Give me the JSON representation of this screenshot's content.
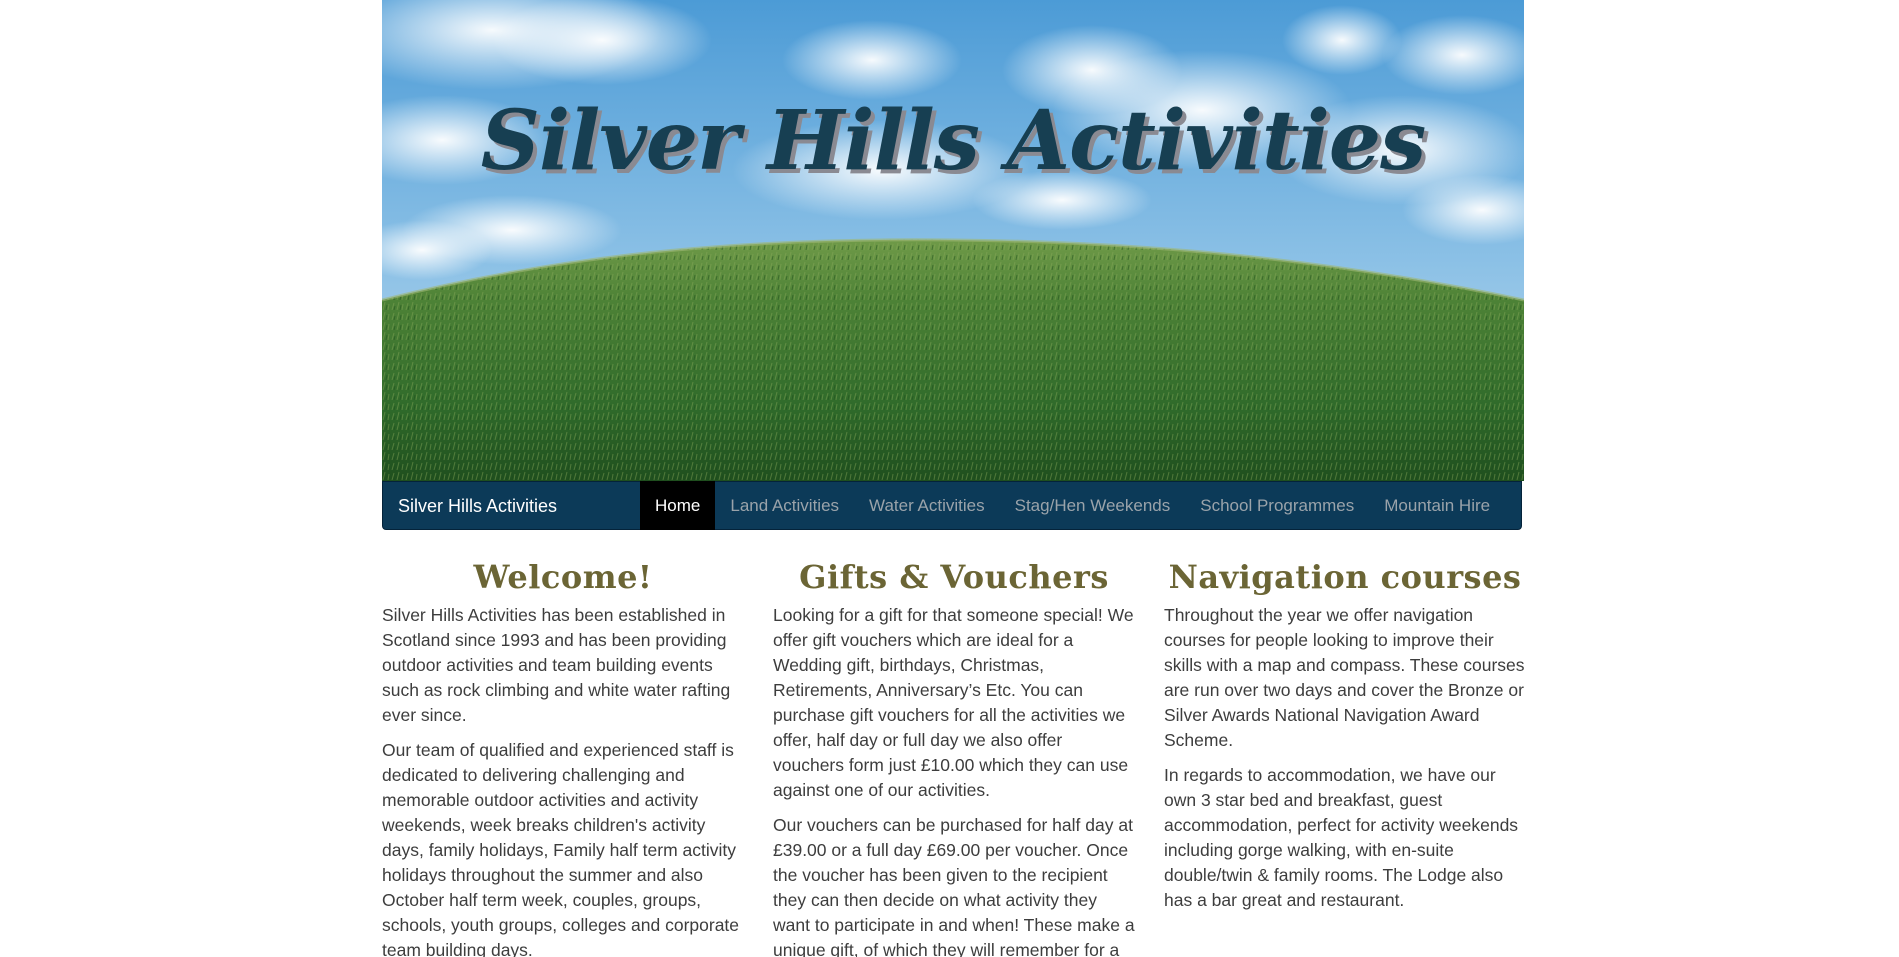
{
  "hero": {
    "title": "Silver Hills Activities"
  },
  "navbar": {
    "brand": "Silver Hills Activities",
    "items": [
      {
        "label": "Home",
        "active": true
      },
      {
        "label": "Land Activities",
        "active": false
      },
      {
        "label": "Water Activities",
        "active": false
      },
      {
        "label": "Stag/Hen Weekends",
        "active": false
      },
      {
        "label": "School Programmes",
        "active": false
      },
      {
        "label": "Mountain Hire",
        "active": false
      }
    ]
  },
  "columns": {
    "welcome": {
      "heading": "Welcome!",
      "paragraphs": [
        "Silver Hills Activities has been established in Scotland since 1993 and has been providing outdoor activities and team building events such as rock climbing and white water rafting ever since.",
        "Our team of qualified and experienced staff is dedicated to delivering challenging and memorable outdoor activities and activity weekends, week breaks children's activity days, family holidays, Family half term activity holidays throughout the summer and also October half term week, couples, groups, schools, youth groups, colleges and corporate team building days."
      ]
    },
    "gifts": {
      "heading": "Gifts & Vouchers",
      "paragraphs": [
        "Looking for a gift for that someone special! We offer gift vouchers which are ideal for a Wedding gift, birthdays, Christmas, Retirements, Anniversary’s Etc. You can purchase gift vouchers for all the activities we offer, half day or full day we also offer vouchers form just £10.00 which they can use against one of our activities.",
        "Our vouchers can be purchased for half day at £39.00 or a full day £69.00 per voucher. Once the voucher has been given to the recipient they can then decide on what activity they want to participate in and when! These make a unique gift, of which they will remember for a long time."
      ]
    },
    "navigation": {
      "heading": "Navigation courses",
      "paragraphs": [
        "Throughout the year we offer navigation courses for people looking to improve their skills with a map and compass. These courses are run over two days and cover the Bronze or Silver Awards National Navigation Award Scheme.",
        "In regards to accommodation, we have our own 3 star bed and breakfast, guest accommodation, perfect for activity weekends including gorge walking, with en-suite double/twin & family rooms. The Lodge also has a bar great and restaurant."
      ]
    }
  },
  "colors": {
    "navbar_bg": "#0c3a58",
    "heading": "#6b6535",
    "hero_title": "#173f52",
    "sky": "#5aa7dc",
    "grass": "#3f7a32"
  }
}
